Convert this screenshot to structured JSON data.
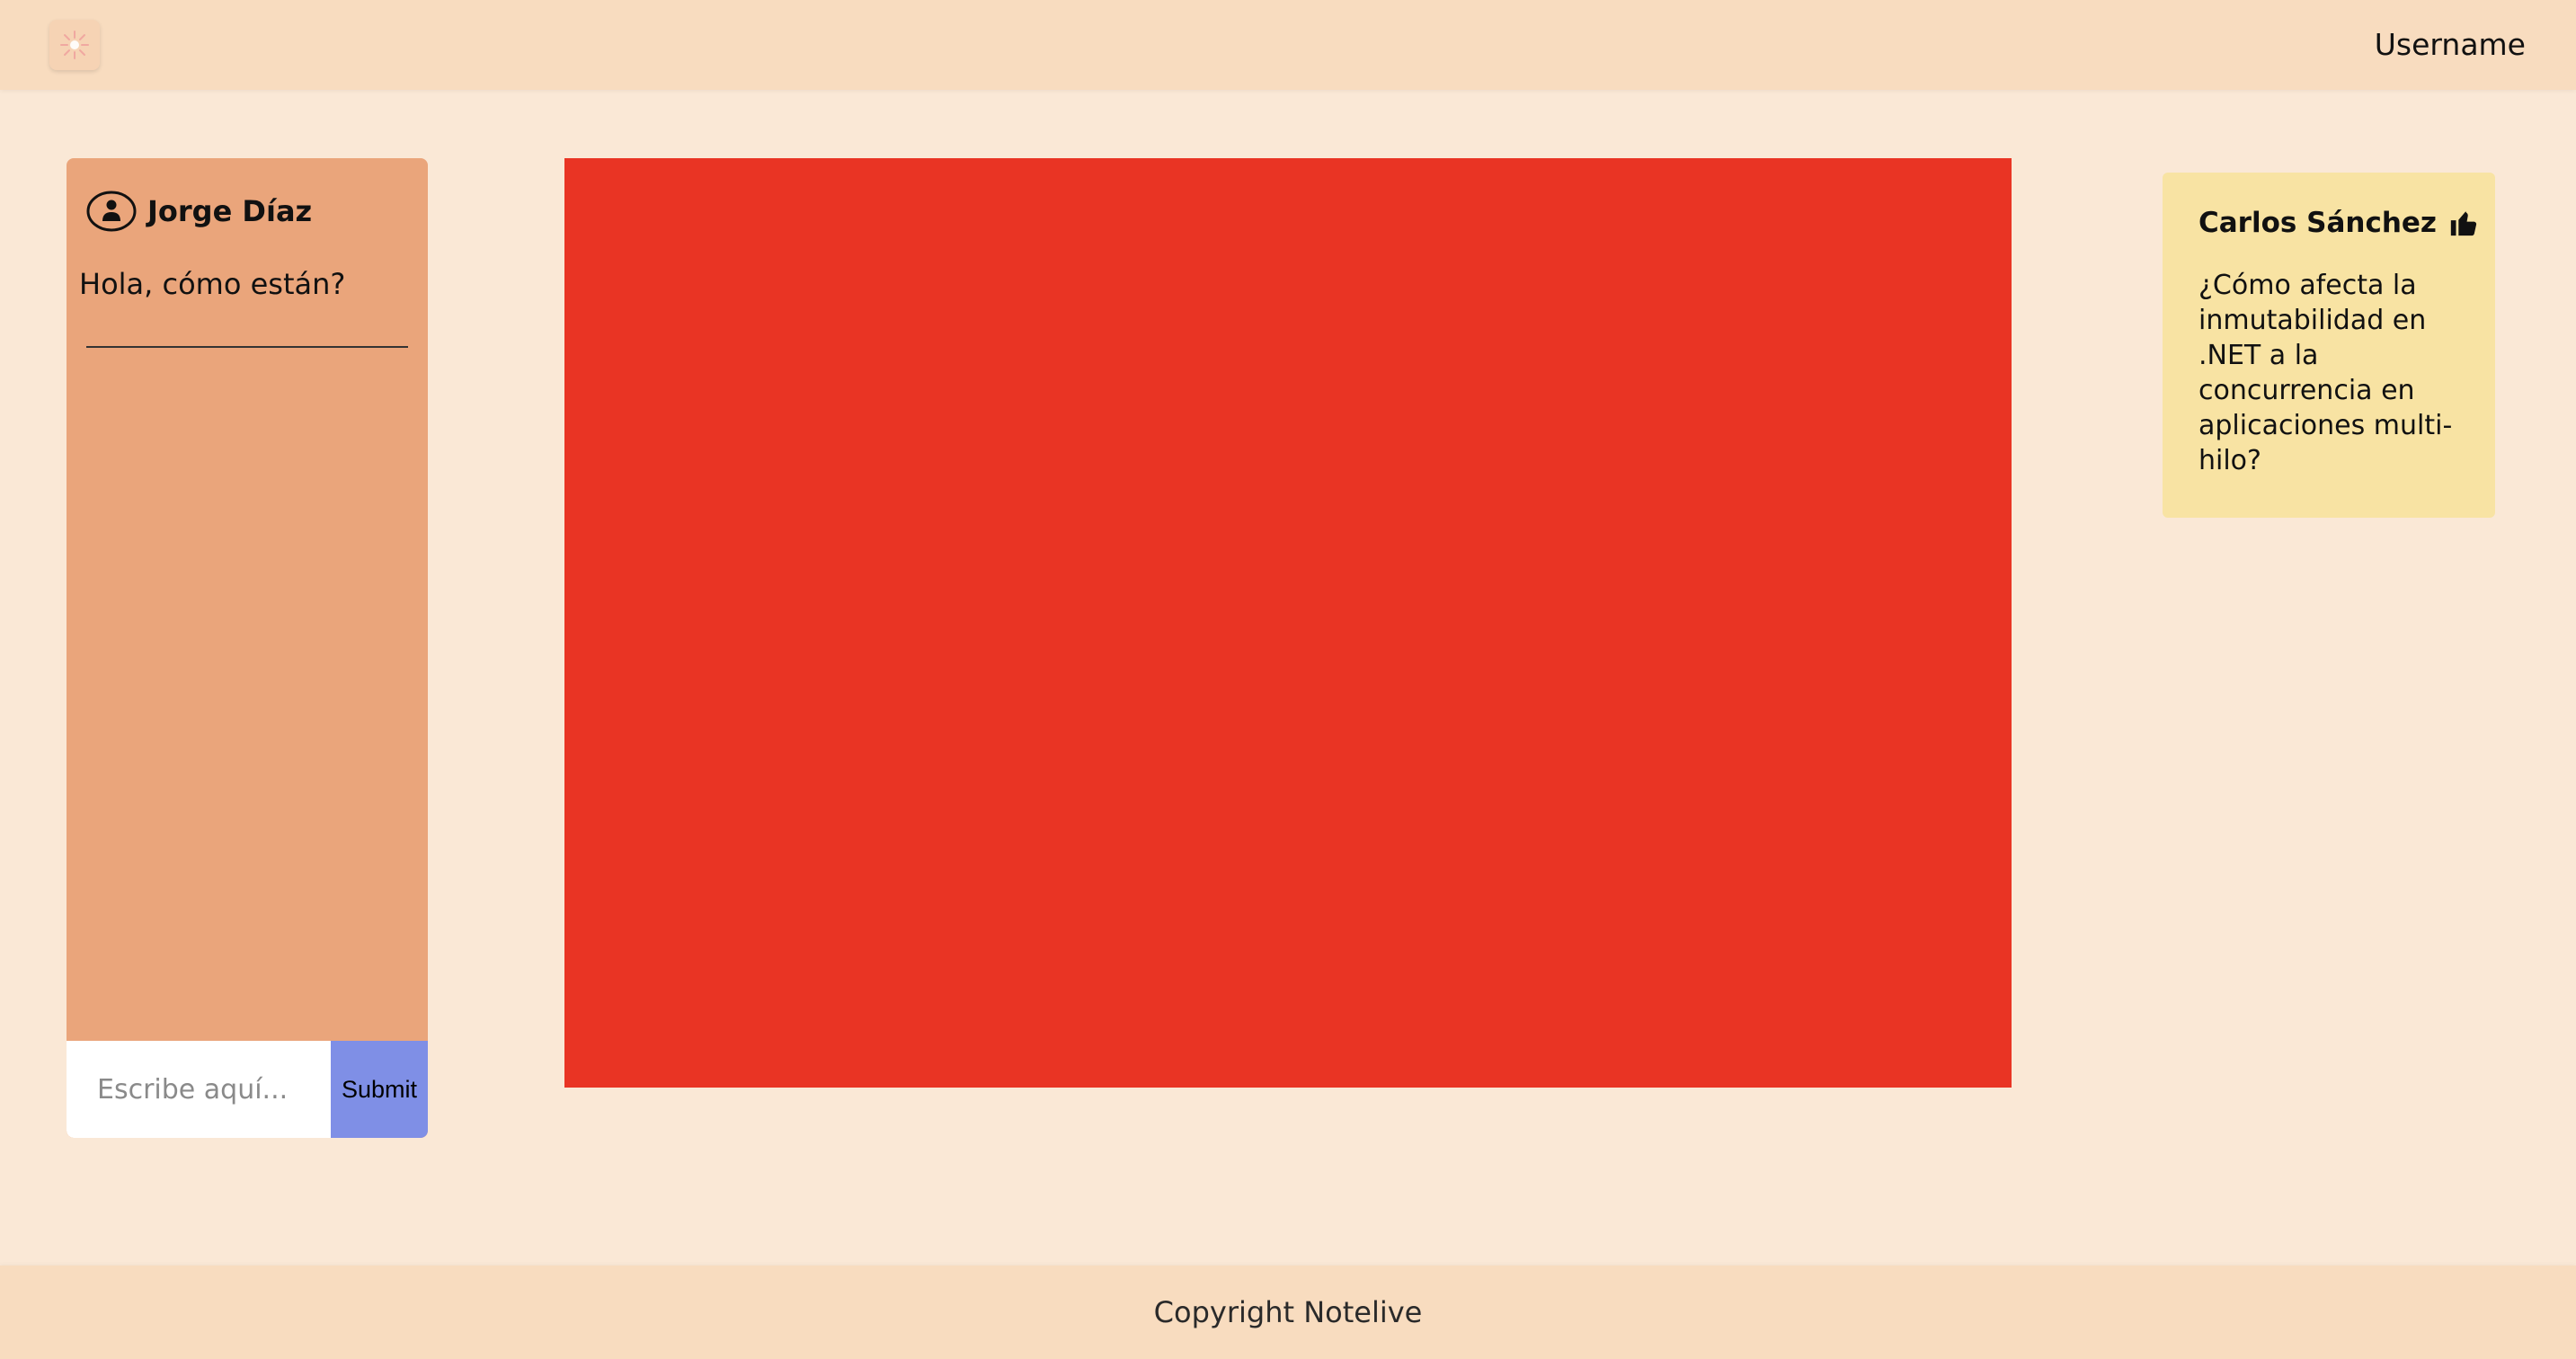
{
  "header": {
    "logo_icon": "sparkle-logo-icon",
    "username": "Username"
  },
  "chat": {
    "messages": [
      {
        "author_icon": "user-circle-icon",
        "author": "Jorge Díaz",
        "text": "Hola, cómo están?"
      }
    ],
    "input": {
      "value": "",
      "placeholder": "Escribe aquí..."
    },
    "submit_label": "Submit"
  },
  "video": {
    "color": "#e93424"
  },
  "questions": [
    {
      "author": "Carlos Sánchez",
      "like_icon": "thumbs-up-icon",
      "text": "¿Cómo afecta la inmutabilidad en .NET a la concurrencia en aplicaciones multi-hilo?"
    }
  ],
  "footer": {
    "copyright": "Copyright Notelive"
  },
  "colors": {
    "header_bg": "#f8dcbf",
    "page_bg": "#fae8d6",
    "chat_panel_bg": "#eaa57b",
    "submit_bg": "#7f8fe6",
    "question_card_bg": "#f8e3a3"
  }
}
